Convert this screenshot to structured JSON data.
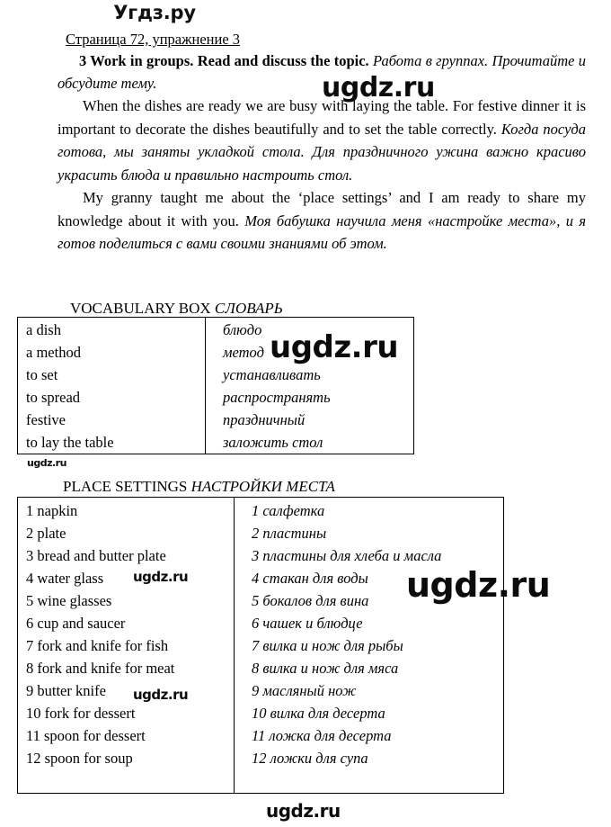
{
  "brand": {
    "header_logo": "Угдз.ру",
    "watermark": "ugdz.ru"
  },
  "document": {
    "page_reference": "Страница 72, упражнение 3",
    "exercise": {
      "number": "3",
      "instruction_en": "3 Work in groups. Read and discuss the topic.",
      "instruction_ru": "Работа в группах. Прочитайте и обсудите тему."
    },
    "paragraphs": [
      {
        "en": "When the dishes are ready we are busy with laying the table. For festive dinner it is important to decorate the dishes beautifully and to set the table correctly.",
        "ru": "Когда посуда готова, мы заняты укладкой стола. Для праздничного ужина важно красиво украсить блюда и правильно настроить стол."
      },
      {
        "en": "My granny taught me about the ‘place settings’ and I am ready to share my knowledge about it with you.",
        "ru": "Моя бабушка научила меня «настройке места», и я готов поделиться с вами своими знаниями об этом."
      }
    ],
    "vocabulary_box": {
      "caption_en": "VOCABULARY BOX",
      "caption_ru": "СЛОВАРЬ",
      "rows": [
        {
          "en": "a dish",
          "ru": "блюдо"
        },
        {
          "en": "a method",
          "ru": "метод"
        },
        {
          "en": "to set",
          "ru": "устанавливать"
        },
        {
          "en": "to spread",
          "ru": "распространять"
        },
        {
          "en": "festive",
          "ru": "праздничный"
        },
        {
          "en": "to lay the table",
          "ru": "заложить стол"
        }
      ]
    },
    "place_settings_box": {
      "caption_en": "PLACE SETTINGS",
      "caption_ru": "НАСТРОЙКИ МЕСТА",
      "rows": [
        {
          "en": "1 napkin",
          "ru": "1 салфетка"
        },
        {
          "en": "2 plate",
          "ru": "2 пластины"
        },
        {
          "en": "3 bread and butter plate",
          "ru": "3 пластины для хлеба и масла"
        },
        {
          "en": "4 water glass",
          "ru": "4 стакан для воды"
        },
        {
          "en": "5 wine glasses",
          "ru": "5 бокалов для вина"
        },
        {
          "en": "6 cup and saucer",
          "ru": "6 чашек и блюдце"
        },
        {
          "en": "7 fork and knife for fish",
          "ru": "7 вилка и нож для рыбы"
        },
        {
          "en": "8 fork and knife for meat",
          "ru": "8 вилка и нож для мяса"
        },
        {
          "en": "9 butter knife",
          "ru": "9 масляный нож"
        },
        {
          "en": "10 fork for dessert",
          "ru": "10 вилка для десерта"
        },
        {
          "en": "11 spoon for dessert",
          "ru": "11 ложка для десерта"
        },
        {
          "en": "12 spoon for soup",
          "ru": "12 ложки для супа"
        }
      ]
    }
  },
  "colors": {
    "text": "#000000",
    "background": "#ffffff",
    "border": "#000000",
    "watermark": "#0b0b0b"
  }
}
